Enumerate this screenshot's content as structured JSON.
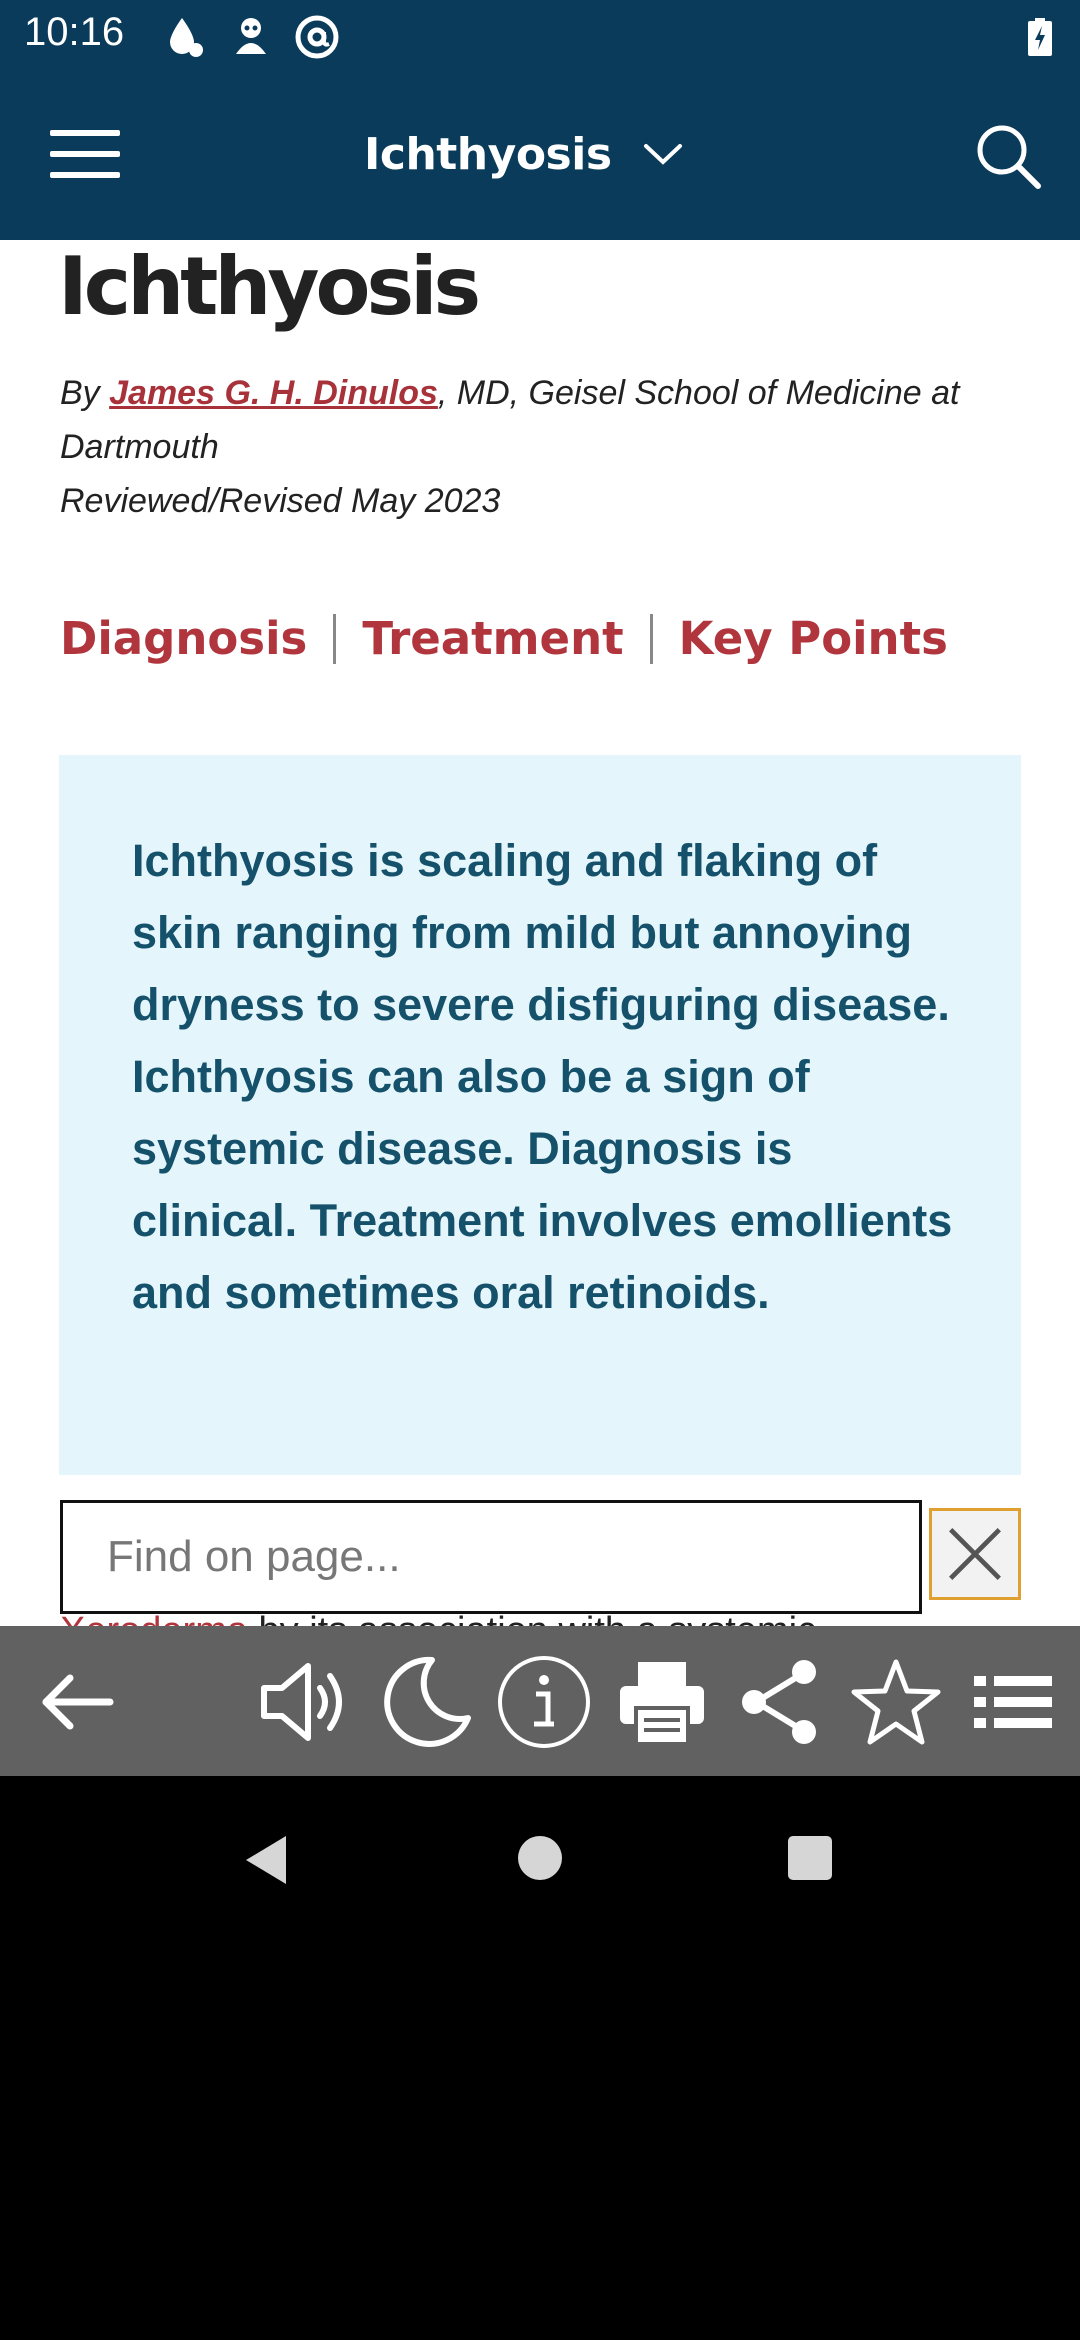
{
  "status_bar": {
    "time": "10:16",
    "icons": [
      "water-drop-icon",
      "android-alien-icon",
      "at-sign-icon",
      "battery-charging-icon"
    ]
  },
  "app_bar": {
    "title": "Ichthyosis",
    "icons": [
      "hamburger-menu-icon",
      "chevron-down-icon",
      "search-icon"
    ],
    "background": "#0b3b5a"
  },
  "article": {
    "title": "Ichthyosis",
    "byline_prefix": "By ",
    "author": "James G. H. Dinulos",
    "byline_suffix": ", MD, Geisel School of Medicine at Dartmouth",
    "reviewed": "Reviewed/Revised May 2023",
    "section_links": [
      "Diagnosis",
      "Treatment",
      "Key Points"
    ],
    "summary": "Ichthyosis is scaling and flaking of skin ranging from mild but annoying dryness to severe disfiguring disease. Ichthyosis can also be a sign of systemic disease. Diagnosis is clinical. Treatment involves emollients and sometimes oral retinoids.",
    "partial_text_link": "Xeroderma",
    "partial_text_rest": " by its association with a systemic"
  },
  "find_bar": {
    "placeholder": "Find on page..."
  },
  "toolbar": {
    "icons": [
      "back-arrow-icon",
      "speaker-icon",
      "night-mode-icon",
      "info-icon",
      "print-icon",
      "share-icon",
      "star-icon",
      "list-icon"
    ]
  },
  "nav_bar": {
    "icons": [
      "nav-back-icon",
      "nav-home-icon",
      "nav-recents-icon"
    ]
  },
  "colors": {
    "accent_red": "#b0353d",
    "summary_bg": "#e4f6fb",
    "summary_text": "#15516b",
    "toolbar_bg": "#616161"
  }
}
